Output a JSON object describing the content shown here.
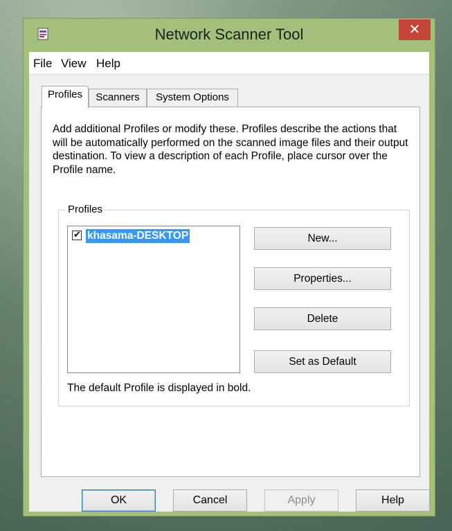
{
  "window": {
    "title": "Network Scanner Tool",
    "close_icon": "close-icon",
    "app_icon": "scanner-app-icon"
  },
  "menubar": {
    "items": [
      {
        "label": "File"
      },
      {
        "label": "View"
      },
      {
        "label": "Help"
      }
    ]
  },
  "tabs": [
    {
      "label": "Profiles",
      "active": true
    },
    {
      "label": "Scanners",
      "active": false
    },
    {
      "label": "System Options",
      "active": false
    }
  ],
  "profiles_tab": {
    "description": "Add additional Profiles or modify these. Profiles describe the actions that will be automatically performed on the scanned image files and their output destination. To view a description of each Profile, place cursor over the Profile name.",
    "group_label": "Profiles",
    "profiles": [
      {
        "name": "khasama-DESKTOP",
        "checked": true,
        "selected": true,
        "is_default": true
      }
    ],
    "buttons": {
      "new": "New...",
      "properties": "Properties...",
      "delete": "Delete",
      "set_default": "Set as Default"
    },
    "footnote": "The default Profile is displayed in bold."
  },
  "dialog_buttons": {
    "ok": "OK",
    "cancel": "Cancel",
    "apply": "Apply",
    "help": "Help"
  },
  "colors": {
    "frame": "#a2c07a",
    "close_button": "#c7443a",
    "selection": "#3399ff"
  }
}
